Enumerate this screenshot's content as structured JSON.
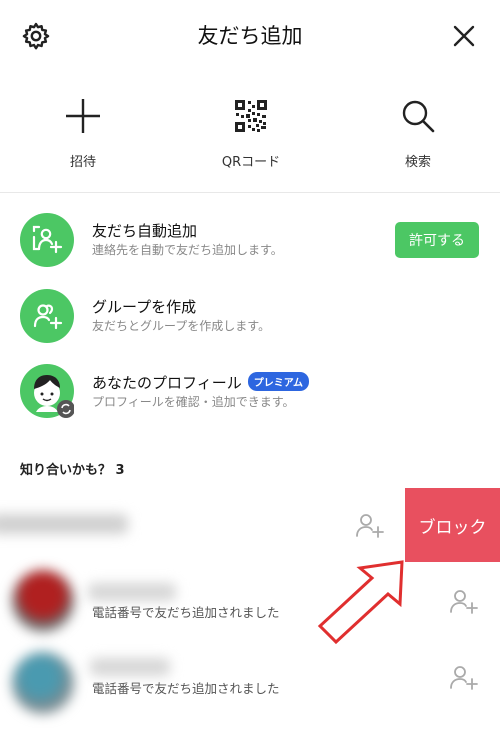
{
  "header": {
    "title": "友だち追加",
    "settings_icon": "gear-icon",
    "close_icon": "close-icon"
  },
  "actions": [
    {
      "label": "招待",
      "icon": "plus-icon"
    },
    {
      "label": "QRコード",
      "icon": "qr-code-icon"
    },
    {
      "label": "検索",
      "icon": "search-icon"
    }
  ],
  "options": [
    {
      "title": "友だち自動追加",
      "subtitle": "連絡先を自動で友だち追加します。",
      "button": "許可する",
      "icon": "auto-add-friend-icon"
    },
    {
      "title": "グループを作成",
      "subtitle": "友だちとグループを作成します。",
      "icon": "group-create-icon"
    },
    {
      "title": "あなたのプロフィール",
      "badge": "プレミアム",
      "subtitle": "プロフィールを確認・追加できます。",
      "icon": "profile-avatar-icon"
    }
  ],
  "suggestions": {
    "header": "知り合いかも？ 3",
    "block_label": "ブロック",
    "items": [
      {
        "subtitle": ""
      },
      {
        "subtitle": "電話番号で友だち追加されました"
      },
      {
        "subtitle": "電話番号で友だち追加されました"
      }
    ]
  },
  "colors": {
    "green": "#4cc764",
    "block_red": "#e8505f",
    "premium_blue": "#2d66e0",
    "arrow_red": "#e02f2f"
  }
}
